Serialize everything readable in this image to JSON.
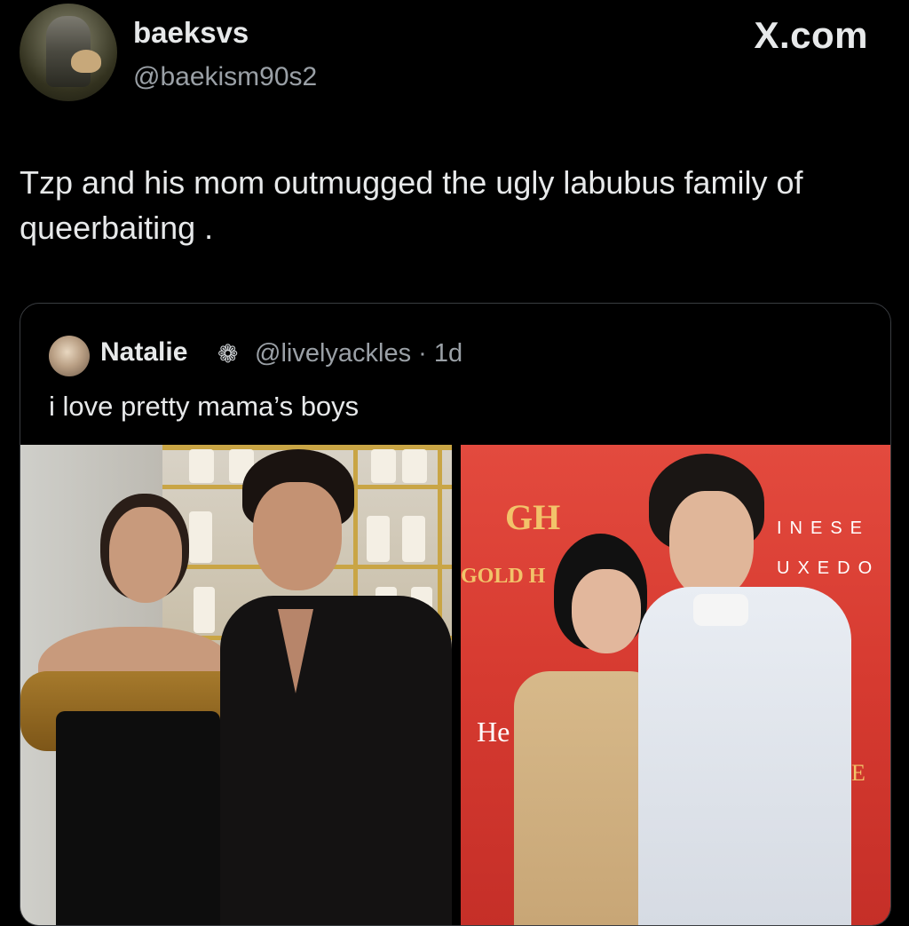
{
  "post": {
    "display_name": "baeksvs",
    "handle": "@baekism90s2",
    "text": "Tzp and his mom outmugged the ugly labubus family of queerbaiting ."
  },
  "site_logo": "X.com",
  "quote": {
    "name": "Natalie",
    "badge": "❁",
    "meta": "@livelyackles · 1d",
    "text": "i love pretty mama’s boys"
  },
  "photo_right_wall": {
    "logo": "GH",
    "gold_text": "GOLD H",
    "letters_1": "INESE",
    "letters_2": "UXEDO",
    "he_text": "He",
    "e_text": "E"
  },
  "colors": {
    "background": "#000000",
    "text_primary": "#e7e9ea",
    "text_secondary": "#9aa0a6",
    "card_border": "#3a3d41",
    "red_wall": "#d63a30",
    "gold": "#c9a545"
  }
}
